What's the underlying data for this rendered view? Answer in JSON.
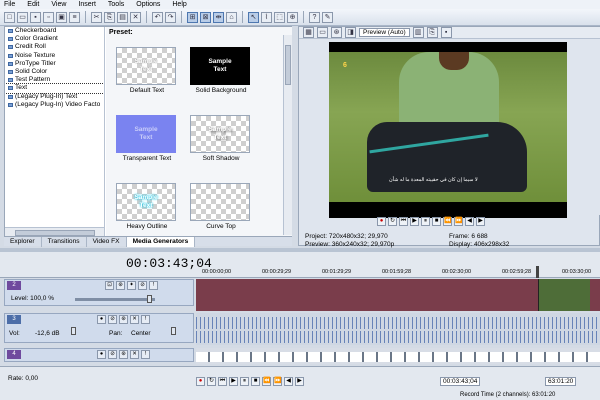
{
  "menu": [
    "File",
    "Edit",
    "View",
    "Insert",
    "Tools",
    "Options",
    "Help"
  ],
  "tree": [
    "Checkerboard",
    "Color Gradient",
    "Credit Roll",
    "Noise Texture",
    "ProType Titler",
    "Solid Color",
    "Test Pattern",
    "Text",
    "(Legacy Plug-In) Text",
    "(Legacy Plug-In) Video Facto"
  ],
  "presets": {
    "title": "Preset:",
    "items": [
      {
        "thumb": "Sample\nText",
        "label": "Default Text"
      },
      {
        "thumb": "Sample\nText",
        "label": "Solid Background"
      },
      {
        "thumb": "Sample\nText",
        "label": "Transparent Text"
      },
      {
        "thumb": "Sample\nText",
        "label": "Soft Shadow"
      },
      {
        "thumb": "Sample\nText",
        "label": "Heavy Outline"
      },
      {
        "thumb": "Sample\nText",
        "label": "Curve Top"
      }
    ]
  },
  "tabs": [
    "Explorer",
    "Transitions",
    "Video FX",
    "Media Generators"
  ],
  "preview": {
    "mode": "Preview (Auto)",
    "logo": "6",
    "subtitle": "لا سيما إن كان في حقيبته المعدة ما له شأن",
    "project_label": "Project:",
    "project_value": "720x480x32; 29,970",
    "preview_label": "Preview:",
    "preview_value": "360x240x32; 29,970p",
    "frame_label": "Frame:",
    "frame_value": "6 688",
    "display_label": "Display:",
    "display_value": "406x298x32"
  },
  "timeline": {
    "timecode": "00:03:43;04",
    "ruler": [
      "00:00:00;00",
      "00:00:29;29",
      "00:01:29;29",
      "00:01:59;28",
      "00:02:30;00",
      "00:02:59;28",
      "00:03:30;00"
    ],
    "tracks": [
      {
        "num": "2",
        "level_label": "Level: 100,0 %"
      },
      {
        "num": "3",
        "vol_label": "Vol:",
        "vol_value": "-12,6 dB",
        "pan_label": "Pan:",
        "pan_value": "Center"
      },
      {
        "num": "4"
      }
    ]
  },
  "bottom": {
    "rate": "Rate: 0,00",
    "timecode": "00:03:43;04",
    "timecode2": "63:01:20",
    "record_time": "Record Time (2 channels): 63:01:20"
  }
}
